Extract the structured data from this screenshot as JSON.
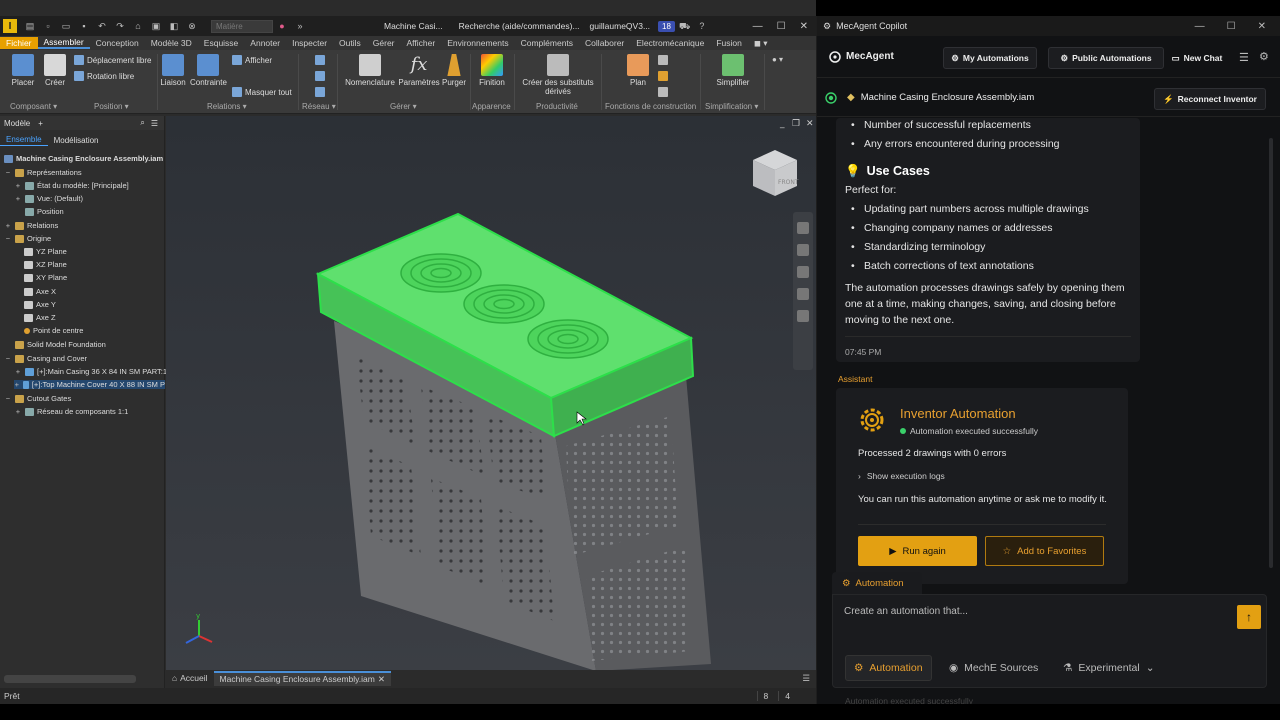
{
  "inventor": {
    "material_placeholder": "Matière",
    "title": "Machine Casi...",
    "search": "Recherche (aide/commandes)...",
    "user": "guillaumeQV3...",
    "notif_count": "18",
    "menus": [
      "Fichier",
      "Assembler",
      "Conception",
      "Modèle 3D",
      "Esquisse",
      "Annoter",
      "Inspecter",
      "Outils",
      "Gérer",
      "Afficher",
      "Environnements",
      "Compléments",
      "Collaborer",
      "Electromécanique",
      "Fusion"
    ],
    "ribbon": {
      "placer": "Placer",
      "creer": "Créer",
      "deplacement": "Déplacement libre",
      "rotation": "Rotation libre",
      "liaison": "Liaison",
      "contrainte": "Contrainte",
      "afficher": "Afficher",
      "masquer": "Masquer tout",
      "nomenclature": "Nomenclature",
      "parametres": "Paramètres",
      "purger": "Purger",
      "finition": "Finition",
      "substituts": "Créer des substituts dérivés",
      "plan": "Plan",
      "simplifier": "Simplifier",
      "groups": {
        "composant": "Composant ▾",
        "position": "Position ▾",
        "relations": "Relations ▾",
        "reseau": "Réseau ▾",
        "gerer": "Gérer ▾",
        "apparence": "Apparence",
        "productivite": "Productivité",
        "fonctions": "Fonctions de construction",
        "simplification": "Simplification ▾"
      }
    },
    "tree": {
      "header": "Modèle",
      "tab_ensemble": "Ensemble",
      "tab_modelisation": "Modélisation",
      "root": "Machine Casing Enclosure Assembly.iam",
      "items": {
        "representations": "Représentations",
        "etat": "État du modèle: [Principale]",
        "vue": "Vue: (Default)",
        "position": "Position",
        "relations": "Relations",
        "origine": "Origine",
        "yz": "YZ Plane",
        "xz": "XZ Plane",
        "xy": "XY Plane",
        "axex": "Axe X",
        "axey": "Axe Y",
        "axez": "Axe Z",
        "centre": "Point de centre",
        "solid": "Solid Model Foundation",
        "casing": "Casing and Cover",
        "main": "[+]:Main Casing 36 X 84 IN SM PART:1",
        "top": "[+]:Top Machine Cover 40 X 88 IN SM P",
        "cutout": "Cutout Gates",
        "reseau": "Réseau de composants 1:1"
      }
    },
    "doctabs": {
      "home": "Accueil",
      "doc": "Machine Casing Enclosure Assembly.iam"
    },
    "status": {
      "left": "Prêt",
      "n1": "8",
      "n2": "4"
    },
    "viewcube_label": "FRONT"
  },
  "mecagent": {
    "window_title": "MecAgent Copilot",
    "logo": "MecAgent",
    "my_automations": "My Automations",
    "public_automations": "Public Automations",
    "new_chat": "New Chat",
    "doc_name": "Machine Casing Enclosure Assembly.iam",
    "reconnect": "Reconnect Inventor",
    "top_bullets": [
      "Number of successful replacements",
      "Any errors encountered during processing"
    ],
    "use_cases_title": "Use Cases",
    "perfect_for": "Perfect for:",
    "use_cases": [
      "Updating part numbers across multiple drawings",
      "Changing company names or addresses",
      "Standardizing terminology",
      "Batch corrections of text annotations"
    ],
    "paragraph": "The automation processes drawings safely by opening them one at a time, making changes, saving, and closing before moving to the next one.",
    "timestamp": "07:45 PM",
    "role": "Assistant",
    "auto_title": "Inventor Automation",
    "auto_status": "Automation executed successfully",
    "processed": "Processed 2 drawings with 0 errors",
    "show_logs": "Show execution logs",
    "can_run": "You can run this automation anytime or ask me to modify it.",
    "run_again": "Run again",
    "add_fav": "Add to Favorites",
    "automation_tab": "Automation",
    "input_placeholder": "Create an automation that...",
    "modes": {
      "automation": "Automation",
      "sources": "MechE Sources",
      "experimental": "Experimental"
    },
    "ghost": "Automation executed successfully"
  },
  "colors": {
    "accent": "#e3a012",
    "selection_green": "#33e05a",
    "success": "#3ad06a"
  }
}
